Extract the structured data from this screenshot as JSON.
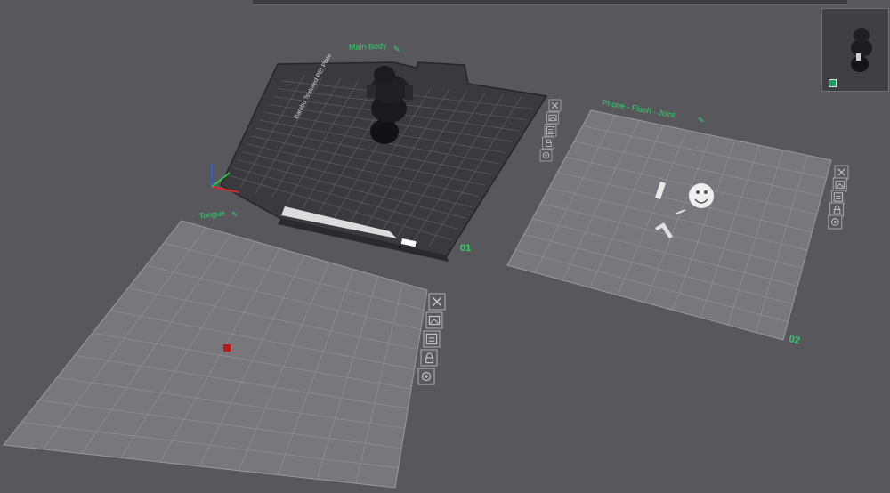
{
  "viewport": {
    "background": "#58585c"
  },
  "plates": [
    {
      "name": "Main Body",
      "number": "01",
      "bed_label": "Bambu Textured PEI Plate",
      "type": "textured-pei"
    },
    {
      "name": "Phone - Flash - Joint",
      "number": "02",
      "type": "empty"
    },
    {
      "name": "Tongue",
      "number": "",
      "type": "empty"
    }
  ],
  "plate_tools": [
    "close-icon",
    "arrange-icon",
    "orient-icon",
    "lock-icon",
    "settings-icon"
  ],
  "edit_icon": "✎",
  "colors": {
    "label_green": "#2ed06a",
    "textured_plate": "#3a3a3e",
    "empty_plate": "#78787c",
    "grid_line": "#8e8e92",
    "red_part": "#c0171d"
  }
}
